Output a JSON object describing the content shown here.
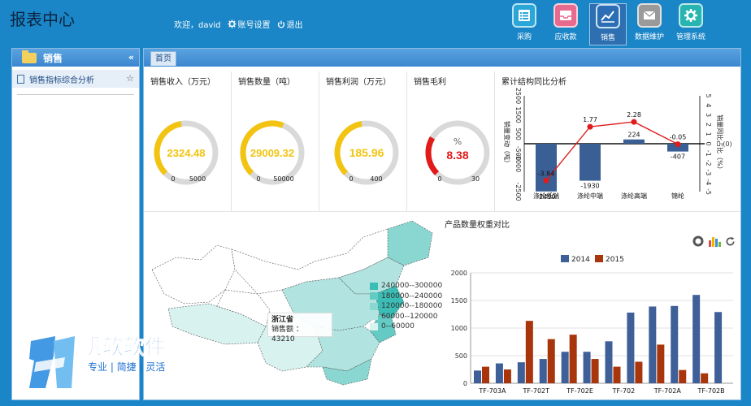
{
  "header": {
    "title": "报表中心",
    "welcome": "欢迎，david",
    "account_settings": "账号设置",
    "logout": "退出"
  },
  "nav": [
    {
      "label": "采购",
      "icon": "list-icon",
      "color": "#2aa7d8",
      "active": false
    },
    {
      "label": "应收款",
      "icon": "inbox-icon",
      "color": "#e86a8e",
      "active": false
    },
    {
      "label": "销售",
      "icon": "trend-chart-icon",
      "color": "#2c6eb5",
      "active": true
    },
    {
      "label": "数据维护",
      "icon": "mail-icon",
      "color": "#9a9a9a",
      "active": false
    },
    {
      "label": "管理系统",
      "icon": "gear-icon",
      "color": "#26b5b0",
      "active": false
    }
  ],
  "sidebar": {
    "title": "销售",
    "collapse_glyph": "«",
    "items": [
      {
        "label": "销售指标综合分析"
      }
    ]
  },
  "tabs": [
    {
      "label": "首页"
    }
  ],
  "gauges": [
    {
      "title": "销售收入（万元）",
      "value": 2324.48,
      "display": "2324.48",
      "min": "0",
      "max": "5000",
      "max_num": 5000,
      "unit": "",
      "color": "#f2c411"
    },
    {
      "title": "销售数量（吨）",
      "value": 29009.32,
      "display": "29009.32",
      "min": "0",
      "max": "50000",
      "max_num": 50000,
      "unit": "",
      "color": "#f2c411"
    },
    {
      "title": "销售利润（万元）",
      "value": 185.96,
      "display": "185.96",
      "min": "0",
      "max": "400",
      "max_num": 400,
      "unit": "",
      "color": "#f2c411"
    },
    {
      "title": "销售毛利",
      "value": 8.38,
      "display": "8.38",
      "min": "0",
      "max": "30",
      "max_num": 30,
      "unit": "%",
      "color": "#e11a1a"
    }
  ],
  "yoy": {
    "title": "累计结构同比分析",
    "ylabel_left": "销量变动（吨）",
    "ylabel_right": "销量同比占比（%）",
    "right_zero": "(0)",
    "left_ticks": [
      "2500",
      "1500",
      "500",
      "-500",
      "-1000",
      "-2500"
    ],
    "right_ticks": [
      "5",
      "4",
      "3",
      "2",
      "1",
      "0",
      "-1",
      "-2",
      "-3",
      "-4",
      "-5"
    ]
  },
  "map": {
    "tooltip_title": "浙江省",
    "tooltip_label": "销售额",
    "tooltip_value": "43210",
    "legend": [
      {
        "label": "240000--300000",
        "color": "#3bbdb6"
      },
      {
        "label": "180000--240000",
        "color": "#63cbc4"
      },
      {
        "label": "120000--180000",
        "color": "#8ad7d1"
      },
      {
        "label": "60000--120000",
        "color": "#b1e4e0"
      },
      {
        "label": "0--60000",
        "color": "#d8f2f0"
      }
    ]
  },
  "bar": {
    "title": "产品数量权重对比",
    "tools": [
      "ring-chart-icon",
      "bar-chart-icon",
      "refresh-icon"
    ]
  },
  "watermark": {
    "brand": "帆软软件",
    "tagline": "专业 | 简捷 | 灵活"
  },
  "chart_data": [
    {
      "type": "bar",
      "title": "累计结构同比分析",
      "categories": [
        "涤纶低端",
        "涤纶中端",
        "涤纶高端",
        "锦纶"
      ],
      "series": [
        {
          "name": "销量变动（吨）",
          "values": [
            -2490,
            -1930,
            224,
            -407
          ],
          "color": "#3a5f95",
          "axis": "left"
        },
        {
          "name": "销量同比占比（%）",
          "type": "line",
          "values": [
            -3.84,
            1.77,
            2.28,
            -0.05
          ],
          "color": "#e01b1b",
          "axis": "right"
        }
      ],
      "ylim": [
        -2500,
        2500
      ],
      "ylim_right": [
        -5,
        5
      ],
      "grid": false
    },
    {
      "type": "bar",
      "title": "产品数量权重对比",
      "categories": [
        "TF-703A",
        "TF-703A",
        "TF-702T",
        "TF-702T",
        "TF-702E",
        "TF-702E",
        "TF-702",
        "TF-702",
        "TF-702A",
        "TF-702A",
        "TF-702B",
        "TF-702B"
      ],
      "x_tick_labels": [
        "TF-703A",
        "TF-702T",
        "TF-702E",
        "TF-702",
        "TF-702A",
        "TF-702B"
      ],
      "series": [
        {
          "name": "2014",
          "color": "#3f5f98",
          "values": [
            230,
            360,
            380,
            440,
            570,
            570,
            760,
            1280,
            1390,
            1400,
            1600,
            1290
          ]
        },
        {
          "name": "2015",
          "color": "#a8350c",
          "values": [
            300,
            250,
            1130,
            800,
            880,
            440,
            300,
            390,
            700,
            240,
            180,
            0
          ]
        }
      ],
      "ylim": [
        0,
        2000
      ],
      "yticks": [
        "2000",
        "1500",
        "1000",
        "500",
        "0"
      ],
      "legend": "top-center",
      "grid": true
    },
    {
      "type": "map",
      "region": "China",
      "highlight": "浙江省",
      "highlight_value": 43210
    }
  ]
}
